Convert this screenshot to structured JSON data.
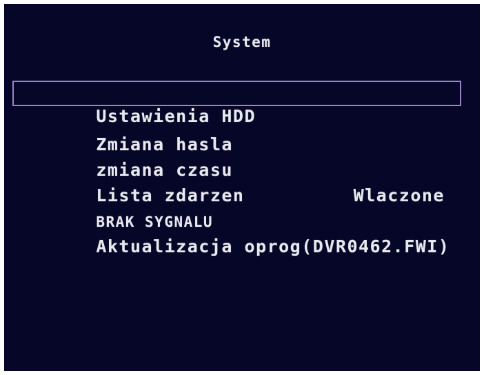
{
  "screen": {
    "title": "System",
    "background_color": "#050628",
    "text_color": "#e8e8ee",
    "selection_color": "#9a86c6"
  },
  "menu": {
    "items": [
      {
        "label": "Ustawienia HDD",
        "value": "",
        "selected": true
      },
      {
        "label": "Zmiana hasla",
        "value": "",
        "selected": false
      },
      {
        "label": "zmiana czasu",
        "value": "",
        "selected": false
      },
      {
        "label": "Lista zdarzen",
        "value": "",
        "selected": false
      },
      {
        "label": "BRAK SYGNALU",
        "value": "Wlaczone",
        "selected": false
      },
      {
        "label": "Aktualizacja oprog(DVR0462.FWI)",
        "value": "",
        "selected": false
      }
    ]
  }
}
